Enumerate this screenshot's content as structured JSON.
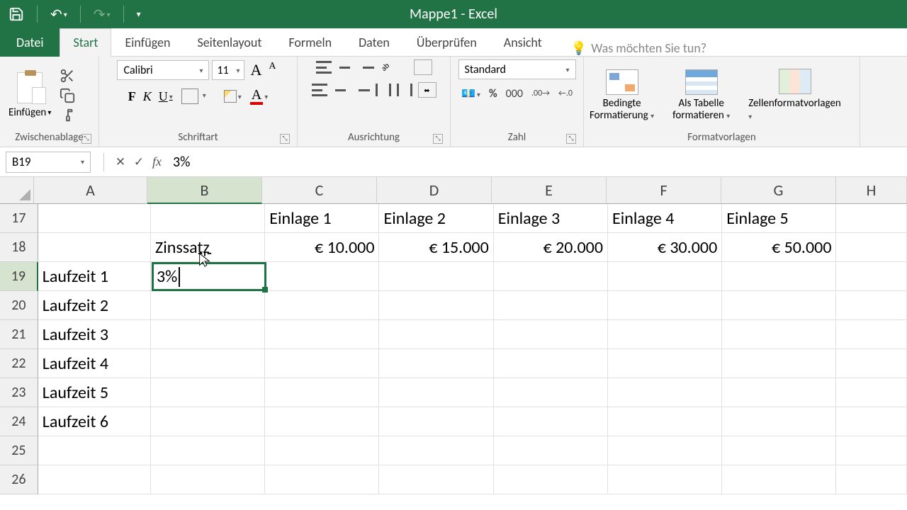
{
  "app_title": "Mappe1 - Excel",
  "tabs": {
    "file": "Datei",
    "home": "Start",
    "insert": "Einfügen",
    "pagelayout": "Seitenlayout",
    "formulas": "Formeln",
    "data": "Daten",
    "review": "Überprüfen",
    "view": "Ansicht",
    "tellme": "Was möchten Sie tun?"
  },
  "ribbon": {
    "clipboard": {
      "label": "Zwischenablage",
      "paste": "Einfügen"
    },
    "font": {
      "label": "Schriftart",
      "name": "Calibri",
      "size": "11"
    },
    "alignment": {
      "label": "Ausrichtung"
    },
    "number": {
      "label": "Zahl",
      "format": "Standard",
      "pct": "%",
      "thousand": "000"
    },
    "styles": {
      "label": "Formatvorlagen",
      "conditional1": "Bedingte",
      "conditional2": "Formatierung",
      "astable1": "Als Tabelle",
      "astable2": "formatieren",
      "cellstyles": "Zellenformatvorlagen"
    }
  },
  "namebox": "B19",
  "formula": "3%",
  "columns": [
    "A",
    "B",
    "C",
    "D",
    "E",
    "F",
    "G",
    "H"
  ],
  "rows": [
    "17",
    "18",
    "19",
    "20",
    "21",
    "22",
    "23",
    "24",
    "25",
    "26"
  ],
  "cells": {
    "C17": "Einlage 1",
    "D17": "Einlage 2",
    "E17": "Einlage 3",
    "F17": "Einlage 4",
    "G17": "Einlage 5",
    "B18": "Zinssatz",
    "C18": "€ 10.000",
    "D18": "€ 15.000",
    "E18": "€ 20.000",
    "F18": "€ 30.000",
    "G18": "€ 50.000",
    "A19": "Laufzeit 1",
    "A20": "Laufzeit 2",
    "A21": "Laufzeit 3",
    "A22": "Laufzeit 4",
    "A23": "Laufzeit 5",
    "A24": "Laufzeit 6"
  },
  "active_value": "3%"
}
